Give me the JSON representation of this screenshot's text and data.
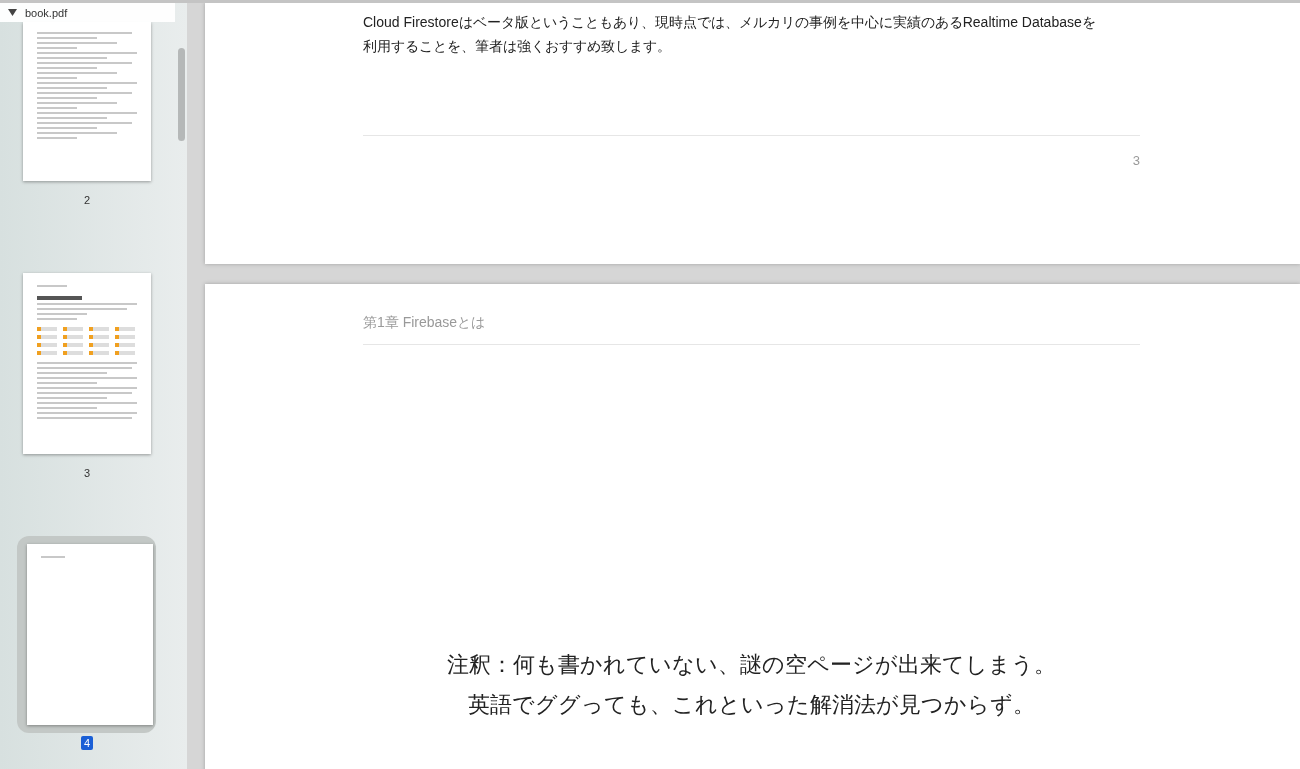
{
  "sidebar": {
    "file": {
      "label": "book.pdf",
      "expanded": true
    },
    "thumbnails": [
      {
        "page": "2",
        "kind": "text",
        "selected": false
      },
      {
        "page": "3",
        "kind": "icons",
        "selected": false
      },
      {
        "page": "4",
        "kind": "blank",
        "selected": true
      }
    ]
  },
  "pages": [
    {
      "kind": "end",
      "body": "Cloud Firestoreはベータ版ということもあり、現時点では、メルカリの事例を中心に実績のあるRealtime Databaseを利用することを、筆者は強くおすすめ致します。",
      "page_number": "3"
    },
    {
      "kind": "start",
      "header": "第1章 Firebaseとは"
    }
  ],
  "note": [
    "注釈：何も書かれていない、謎の空ページが出来てしまう。",
    "英語でググっても、これといった解消法が見つからず。"
  ]
}
